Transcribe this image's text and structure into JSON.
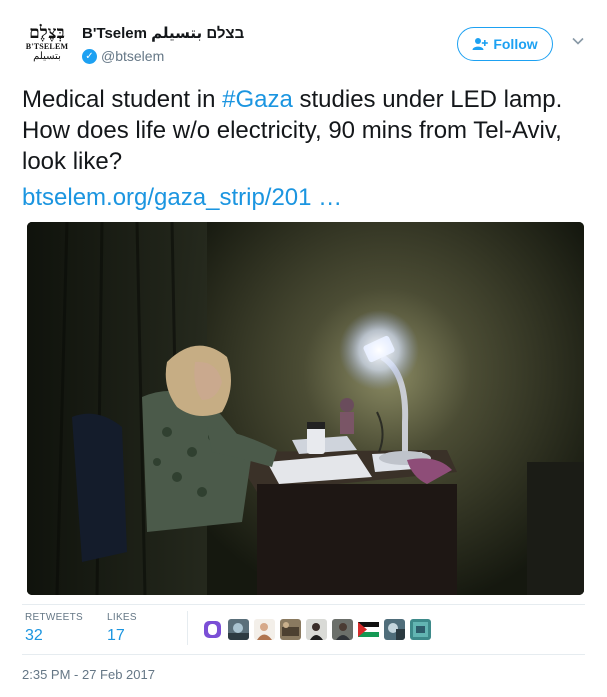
{
  "account": {
    "avatar_hebrew": "בְּצֶלֶם",
    "avatar_english": "B'TSELEM",
    "avatar_arabic": "بتسيلم",
    "display_name": "B'Tselem בצלם بتسيلم",
    "handle": "@btselem",
    "verified": true
  },
  "header": {
    "follow_label": "Follow",
    "follow_icon": "add-person-icon",
    "menu_icon": "chevron-down-icon"
  },
  "tweet": {
    "text_before": "Medical student in ",
    "hashtag": "#Gaza",
    "text_after": " studies under LED lamp. How does life w/o electricity, 90 mins from Tel-Aviv, look like?",
    "link": "btselem.org/gaza_strip/201 …"
  },
  "stats": {
    "retweets_label": "RETWEETS",
    "retweets_value": "32",
    "likes_label": "LIKES",
    "likes_value": "17"
  },
  "timestamp": "2:35 PM - 27 Feb 2017",
  "colors": {
    "link": "#1b95e0",
    "accent": "#1da1f2",
    "muted": "#657786"
  }
}
